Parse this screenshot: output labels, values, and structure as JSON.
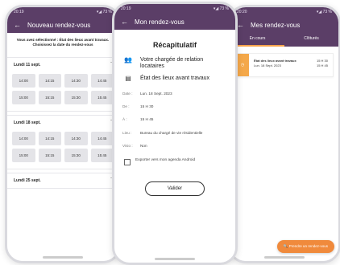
{
  "colors": {
    "primary": "#5b3e67",
    "accent": "#f4a84a",
    "fab": "#f08a3c"
  },
  "left": {
    "status": {
      "time": "20:19",
      "right": "▾◢ 73 %"
    },
    "title": "Nouveau rendez-vous",
    "intro": "Vous avez sélectionné : État des lieux avant travaux. Choisissez la date du rendez-vous",
    "days": [
      {
        "label": "Lundi 11 sept.",
        "slots": [
          "14:00",
          "14:15",
          "14:30",
          "14:45",
          "15:00",
          "15:15",
          "15:30",
          "15:45"
        ]
      },
      {
        "label": "Lundi 18 sept.",
        "slots": [
          "14:00",
          "14:15",
          "14:30",
          "14:45",
          "15:00",
          "15:15",
          "15:30",
          "15:45"
        ]
      },
      {
        "label": "Lundi 25 sept."
      }
    ]
  },
  "middle": {
    "status": {
      "time": "20:19",
      "right": "▾◢ 73 %"
    },
    "title": "Mon rendez-vous",
    "heading": "Récapitulatif",
    "contact": "Votre chargée de relation locataires",
    "service": "État des lieux avant travaux",
    "fields": [
      {
        "k": "Date :",
        "v": "Lun. 18 Sept. 2023"
      },
      {
        "k": "De :",
        "v": "15 H 30"
      },
      {
        "k": "À :",
        "v": "15 H 45"
      },
      {
        "k": "Lieu :",
        "v": "Bureau du chargé de vie résidentielle"
      },
      {
        "k": "Visio :",
        "v": "Non"
      }
    ],
    "export_label": "Exporter vers mon agenda Android",
    "validate": "Valider"
  },
  "right": {
    "status": {
      "time": "20:20",
      "right": "▾◢ 73 %"
    },
    "title": "Mes rendez-vous",
    "tabs": [
      "En cours",
      "Clôturés"
    ],
    "card": {
      "title": "État des lieux avant travaux",
      "date": "Lun. 18 Sept. 2023",
      "from": "15 H 30",
      "to": "15 H 45"
    },
    "fab": "Prendre un rendez-vous"
  }
}
